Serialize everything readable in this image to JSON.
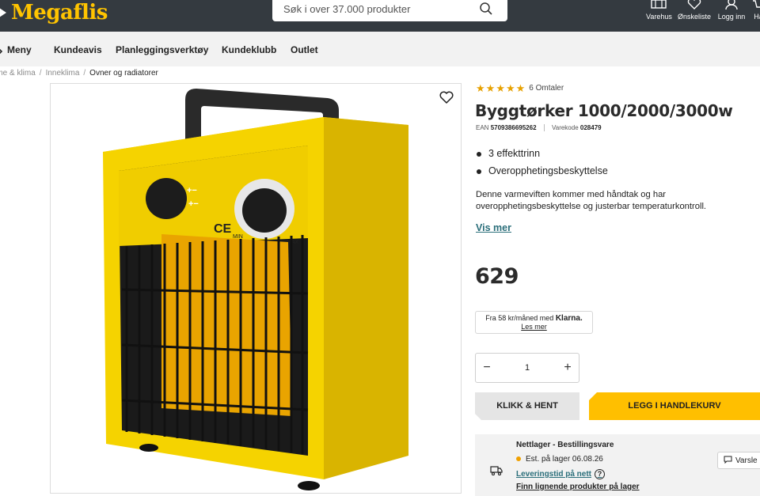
{
  "header": {
    "logo_text": "Megaflis",
    "search_placeholder": "Søk i over 37.000 produkter",
    "icons": [
      {
        "label": "Varehus",
        "icon": "store-icon"
      },
      {
        "label": "Ønskeliste",
        "icon": "heart-icon"
      },
      {
        "label": "Logg inn",
        "icon": "user-icon"
      },
      {
        "label": "Ha",
        "icon": "cart-icon"
      }
    ],
    "bg_color": "#343a40",
    "logo_color": "#ffc400"
  },
  "nav": {
    "items": [
      "Meny",
      "Kundeavis",
      "Planleggingsverktøy",
      "Kundeklubb",
      "Outlet"
    ]
  },
  "breadcrumb": {
    "items": [
      "rme & klima",
      "Inneklima",
      "Ovner og radiatorer"
    ],
    "separator": "/"
  },
  "product": {
    "rating_stars": 5,
    "reviews": "6 Omtaler",
    "title": "Byggtørker 1000/2000/3000w",
    "ean_label": "EAN",
    "ean": "5709386695262",
    "sku_label": "Varekode",
    "sku": "028479",
    "bullets": [
      "3 effekttrinn",
      "Overopphetingsbeskyttelse"
    ],
    "description": "Denne varmeviften kommer med håndtak og har overopphetingsbeskyttelse og justerbar temperaturkontroll.",
    "show_more": "Vis mer",
    "price": "629",
    "klarna_text": "Fra 58 kr/måned med",
    "klarna_brand": "Klarna.",
    "klarna_link": "Les mer",
    "quantity": "1",
    "qty_minus": "−",
    "qty_plus": "+",
    "btn_klikk": "KLIKK & HENT",
    "btn_cart": "LEGG I HANDLEKURV",
    "accent_color": "#ffbf00"
  },
  "stock": {
    "title": "Nettlager - Bestillingsvare",
    "date": "Est. på lager 06.08.26",
    "delivery_link": "Leveringstid på nett",
    "help": "?",
    "similar_link": "Finn lignende produkter på lager",
    "notify": "Varsle"
  }
}
